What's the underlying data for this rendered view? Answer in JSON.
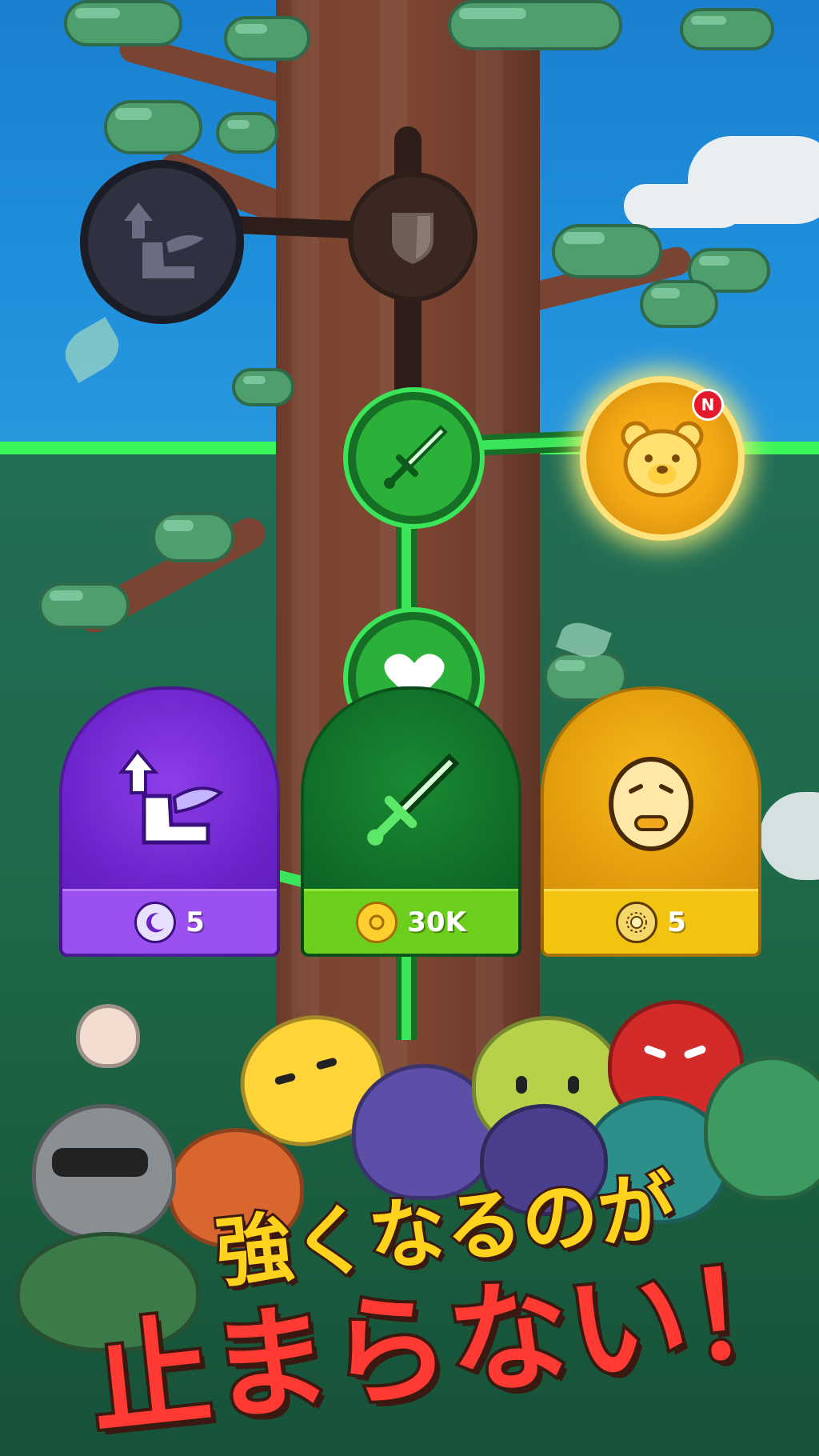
{
  "skill_tree": {
    "nodes": [
      {
        "id": "speed-boost",
        "icon": "winged-boot-up-icon",
        "state": "locked"
      },
      {
        "id": "defense",
        "icon": "shield-icon",
        "state": "locked"
      },
      {
        "id": "attack",
        "icon": "sword-icon",
        "state": "unlocked"
      },
      {
        "id": "health",
        "icon": "heart-icon",
        "state": "unlocked"
      },
      {
        "id": "bear-skill",
        "icon": "bear-face-icon",
        "state": "new",
        "badge": "N"
      }
    ]
  },
  "upgrade_cards": [
    {
      "icon": "winged-boot-up-icon",
      "currency_icon": "moon-coin-icon",
      "price": "5",
      "color": "#6b22c9"
    },
    {
      "icon": "sword-icon",
      "currency_icon": "gold-coin-icon",
      "price": "30K",
      "color": "#0f6a26"
    },
    {
      "icon": "slime-face-icon",
      "currency_icon": "sun-coin-icon",
      "price": "5",
      "color": "#e09a0c"
    }
  ],
  "headline": {
    "line1": "強くなるのが",
    "line2": "止まらない！"
  },
  "colors": {
    "path_active": "#3be55a",
    "path_locked": "#2e1e19",
    "headline_top": "#ffd21e",
    "headline_bottom": "#ff3a32"
  }
}
